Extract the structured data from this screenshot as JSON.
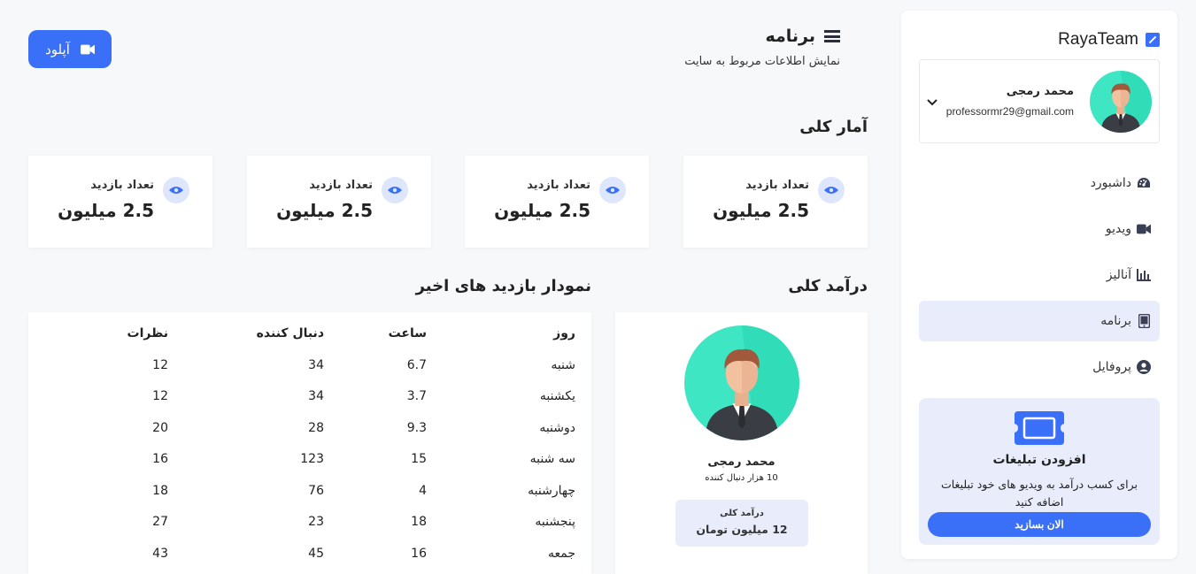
{
  "sidebar": {
    "brand": "RayaTeam",
    "profile": {
      "name": "محمد رمجی",
      "email": "professormr29@gmail.com"
    },
    "nav": [
      {
        "label": "داشبورد",
        "icon": "gauge-icon",
        "active": false
      },
      {
        "label": "ویدیو",
        "icon": "video-icon",
        "active": false
      },
      {
        "label": "آنالیز",
        "icon": "chart-icon",
        "active": false
      },
      {
        "label": "برنامه",
        "icon": "tablet-icon",
        "active": true
      },
      {
        "label": "پروفایل",
        "icon": "user-circle-icon",
        "active": false
      }
    ],
    "promo": {
      "title": "افزودن تبلیغات",
      "description": "برای کسب درآمد به ویدیو های خود تبلیغات اضافه کنید",
      "button": "الان بسازید"
    }
  },
  "header": {
    "title": "برنامه",
    "subtitle": "نمایش اطلاعات مربوط به سایت",
    "upload_label": "آپلود"
  },
  "stats": {
    "title": "آمار کلی",
    "cards": [
      {
        "label": "تعداد بازدید",
        "value": "2.5 میلیون"
      },
      {
        "label": "تعداد بازدید",
        "value": "2.5 میلیون"
      },
      {
        "label": "تعداد بازدید",
        "value": "2.5 میلیون"
      },
      {
        "label": "تعداد بازدید",
        "value": "2.5 میلیون"
      }
    ]
  },
  "income": {
    "title": "درآمد کلی",
    "name": "محمد رمجی",
    "followers": "10 هزار دنبال کننده",
    "box_label": "درآمد کلی",
    "box_value": "12 میلیون تومان"
  },
  "visits": {
    "title": "نمودار بازدید های اخیر",
    "headers": [
      "روز",
      "ساعت",
      "دنبال کننده",
      "نظرات"
    ],
    "rows": [
      [
        "شنبه",
        "6.7",
        "34",
        "12"
      ],
      [
        "یکشنبه",
        "3.7",
        "34",
        "12"
      ],
      [
        "دوشنبه",
        "9.3",
        "28",
        "20"
      ],
      [
        "سه شنبه",
        "15",
        "123",
        "16"
      ],
      [
        "چهارشنبه",
        "4",
        "76",
        "18"
      ],
      [
        "پنجشنبه",
        "18",
        "23",
        "27"
      ],
      [
        "جمعه",
        "16",
        "45",
        "43"
      ]
    ]
  },
  "colors": {
    "accent": "#3a6ff8",
    "accent_light": "#e9edfb",
    "avatar_bg": "#3ee0bd"
  }
}
